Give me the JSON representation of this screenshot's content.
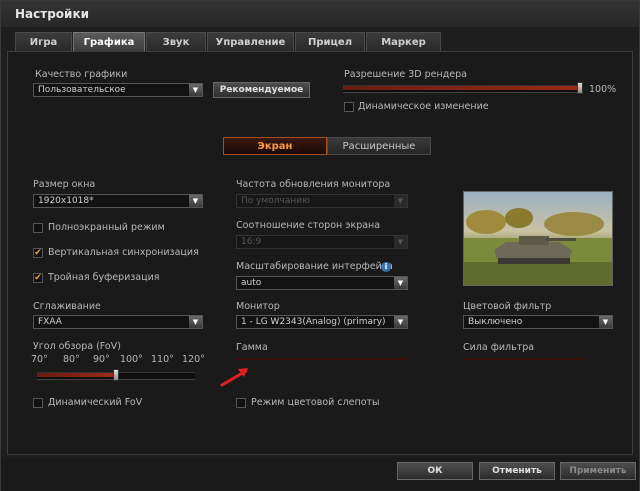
{
  "window": {
    "title": "Настройки"
  },
  "tabs": [
    "Игра",
    "Графика",
    "Звук",
    "Управление",
    "Прицел",
    "Маркер"
  ],
  "quality": {
    "label": "Качество графики",
    "value": "Пользовательское",
    "recommended_button": "Рекомендуемое"
  },
  "render": {
    "label": "Разрешение 3D рендера",
    "percent": "100%",
    "level": 1.0,
    "dynamic_label": "Динамическое изменение",
    "dynamic_checked": false
  },
  "subtabs": [
    "Экран",
    "Расширенные"
  ],
  "left": {
    "window_size_label": "Размер окна",
    "window_size_value": "1920x1018*",
    "fullscreen_label": "Полноэкранный режим",
    "vsync_label": "Вертикальная синхронизация",
    "triple_buffer_label": "Тройная буферизация",
    "aa_label": "Сглаживание",
    "aa_value": "FXAA",
    "fov_label": "Угол обзора (FoV)",
    "fov_ticks": [
      "70°",
      "80°",
      "90°",
      "100°",
      "110°",
      "120°"
    ],
    "fov_value_deg": 95,
    "dynamic_fov_label": "Динамический FoV"
  },
  "middle": {
    "refresh_label": "Частота обновления монитора",
    "refresh_value": "По умолчанию",
    "aspect_label": "Соотношение сторон экрана",
    "aspect_value": "16:9",
    "scale_label": "Масштабирование интерфейса",
    "scale_value": "auto",
    "monitor_label": "Монитор",
    "monitor_value": "1 - LG W2343(Analog) (primary)",
    "gamma_label": "Гамма",
    "colorblind_label": "Режим цветовой слепоты"
  },
  "right": {
    "filter_label": "Цветовой фильтр",
    "filter_value": "Выключено",
    "strength_label": "Сила фильтра"
  },
  "footer": {
    "ok": "ОК",
    "cancel": "Отменить",
    "apply": "Применить"
  },
  "icons": {
    "check": "✔",
    "dropdown": "▼",
    "info": "i"
  },
  "colors": {
    "accent": "#ff9a40",
    "check": "#e0b040",
    "cursor_arrow": "#e02020"
  }
}
